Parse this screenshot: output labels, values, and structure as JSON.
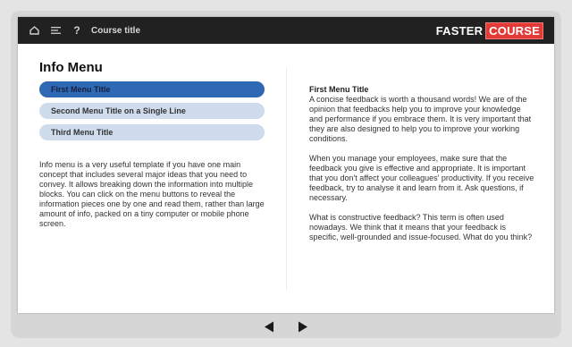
{
  "topbar": {
    "icons": [
      "home-icon",
      "menu-icon",
      "help-icon"
    ],
    "help_label": "?",
    "course_title": "Course title",
    "logo_left": "FASTER",
    "logo_right": "COURSE",
    "logo_color": "#e43a37"
  },
  "left": {
    "title": "Info Menu",
    "menu": [
      {
        "label": "First Menu Title",
        "active": true
      },
      {
        "label": "Second Menu Title on a Single Line",
        "active": false
      },
      {
        "label": "Third Menu Title",
        "active": false
      }
    ],
    "intro": "Info menu is a very useful template if you have one main concept that includes several major ideas that you need to convey. It allows breaking down the information into multiple blocks. You can click on the menu buttons to reveal the information pieces one by one and read them, rather than large amount of info, packed on a tiny computer or mobile phone screen."
  },
  "right": {
    "heading": "First Menu Title",
    "paragraphs": [
      "A concise feedback is worth a thousand words! We are of the opinion that feedbacks help you to improve your knowledge and performance if you embrace them. It is very important that they are also designed to help you to improve your working conditions.",
      "When you manage your employees, make sure that the feedback you give is effective and appropriate. It is important that you don't affect your colleagues' productivity. If you receive feedback, try to analyse it and learn from it. Ask questions, if necessary.",
      "What is constructive feedback? This term is often used nowadays. We think that it means that your feedback is specific, well-grounded and issue-focused. What do you think?"
    ]
  },
  "nav": {
    "icons": [
      "prev-arrow-icon",
      "next-arrow-icon"
    ]
  },
  "colors": {
    "accent": "#2f68b5",
    "menu_inactive": "#cfdced",
    "topbar": "#212121"
  }
}
